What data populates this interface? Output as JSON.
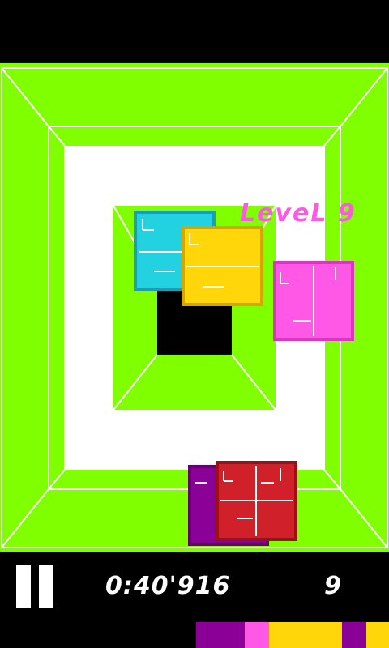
{
  "hud": {
    "timer": "0:40'916",
    "score": "9",
    "level_text": "LeveL 9"
  },
  "colors": {
    "background": "#000000",
    "lime": "#80ff00",
    "white": "#ffffff",
    "cyan": "#22d2e0",
    "yellow": "#ffd60a",
    "pink": "#ff57e6",
    "purple": "#8b0096",
    "red": "#d0202a"
  },
  "blocks": [
    {
      "id": "cyan",
      "color": "cyan"
    },
    {
      "id": "yellow",
      "color": "yellow"
    },
    {
      "id": "pink",
      "color": "pink"
    },
    {
      "id": "purple",
      "color": "purple"
    },
    {
      "id": "red",
      "color": "red"
    }
  ],
  "next_queue": [
    "purple",
    "pink",
    "yellow",
    "purple",
    "yellow"
  ]
}
